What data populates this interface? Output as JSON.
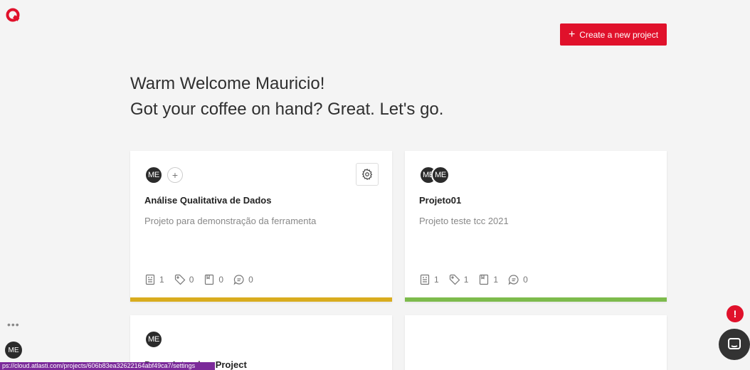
{
  "header": {
    "create_button": "Create a new project",
    "create_plus": "+"
  },
  "welcome": {
    "line1": "Warm Welcome Mauricio!",
    "line2": "Got your coffee on hand? Great. Let's go."
  },
  "projects": [
    {
      "members": [
        "ME"
      ],
      "title": "Análise Qualitativa de Dados",
      "description": "Projeto para demonstração da ferramenta",
      "stats": {
        "documents": "1",
        "tags": "0",
        "highlights": "0",
        "comments": "0"
      },
      "accent_color": "#d9ac1e"
    },
    {
      "members": [
        "ME",
        "ME"
      ],
      "title": "Projeto01",
      "description": "Projeto teste tcc 2021",
      "stats": {
        "documents": "1",
        "tags": "1",
        "highlights": "1",
        "comments": "0"
      },
      "accent_color": "#7dbb4c"
    },
    {
      "members": [
        "ME"
      ],
      "title": "Demo Interview Project"
    }
  ],
  "sidebar": {
    "more": "•••",
    "user_initials": "ME"
  },
  "support": {
    "alert": "!"
  },
  "status_url": "ps://cloud.atlasti.com/projects/606b83ea32622164abf49ca7/settings",
  "colors": {
    "brand_red": "#e0112b",
    "avatar": "#2b2b2b",
    "status_bar": "#7b2a9a"
  }
}
